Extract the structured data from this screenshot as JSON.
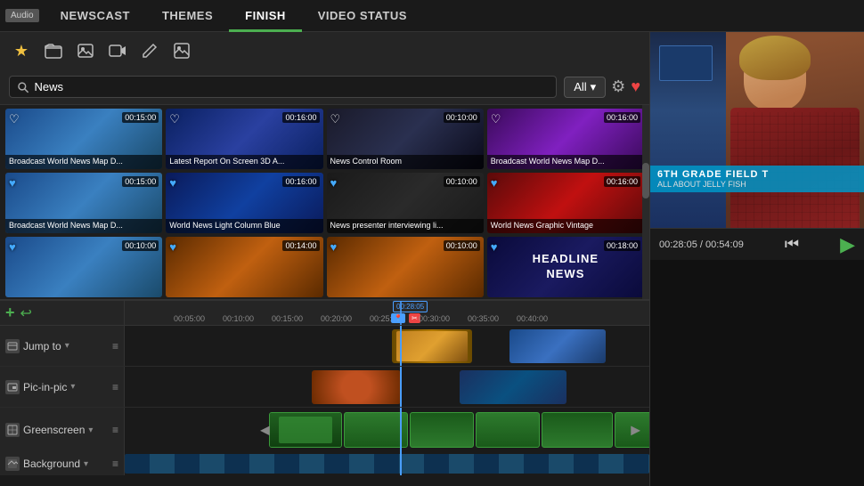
{
  "nav": {
    "audio_badge": "Audio",
    "tabs": [
      "NEWSCAST",
      "THEMES",
      "FINISH",
      "VIDEO STATUS"
    ],
    "active_tab": "NEWSCAST"
  },
  "toolbar": {
    "icons": [
      "★",
      "📁",
      "🖼",
      "📽",
      "✏",
      "🖼"
    ]
  },
  "search": {
    "placeholder": "News",
    "value": "News",
    "filter_label": "All",
    "filter_arrow": "▾"
  },
  "media_items": [
    {
      "id": 1,
      "label": "Broadcast World News Map D...",
      "time": "00:15:00",
      "color": "blue"
    },
    {
      "id": 2,
      "label": "Latest Report On Screen 3D A...",
      "time": "00:16:00",
      "color": "blue"
    },
    {
      "id": 3,
      "label": "News Control Room",
      "time": "00:10:00",
      "color": "dark"
    },
    {
      "id": 4,
      "label": "Broadcast World News Map D...",
      "time": "00:16:00",
      "color": "purple"
    },
    {
      "id": 5,
      "label": "Broadcast World News Map D...",
      "time": "00:15:00",
      "color": "blue"
    },
    {
      "id": 6,
      "label": "World News Light Column Blue",
      "time": "00:16:00",
      "color": "blue"
    },
    {
      "id": 7,
      "label": "News presenter interviewing li...",
      "time": "00:10:00",
      "color": "dark"
    },
    {
      "id": 8,
      "label": "World News Graphic Vintage",
      "time": "00:16:00",
      "color": "red"
    },
    {
      "id": 9,
      "label": "",
      "time": "00:10:00",
      "color": "blue"
    },
    {
      "id": 10,
      "label": "",
      "time": "00:14:00",
      "color": "orange"
    },
    {
      "id": 11,
      "label": "",
      "time": "00:10:00",
      "color": "orange"
    },
    {
      "id": 12,
      "label": "HEADLINE NEWS",
      "time": "00:18:00",
      "color": "blue"
    }
  ],
  "preview": {
    "current_time": "00:28:05",
    "total_time": "00:54:09",
    "lower_third_title": "6TH GRADE FIELD T",
    "lower_third_sub": "ALL ABOUT JELLY FISH"
  },
  "timeline": {
    "playhead_time": "00:28:05",
    "ticks": [
      {
        "label": "00:05:00",
        "pos": 55
      },
      {
        "label": "00:10:00",
        "pos": 110
      },
      {
        "label": "00:15:00",
        "pos": 165
      },
      {
        "label": "00:20:00",
        "pos": 220
      },
      {
        "label": "00:25:00",
        "pos": 275
      },
      {
        "label": "00:28:05",
        "pos": 309
      },
      {
        "label": "00:30:00",
        "pos": 330
      },
      {
        "label": "00:35:00",
        "pos": 385
      },
      {
        "label": "00:40:00",
        "pos": 440
      }
    ],
    "tracks": [
      {
        "id": "jump-to",
        "label": "Jump to"
      },
      {
        "id": "pic-in-pic",
        "label": "Pic-in-pic"
      },
      {
        "id": "greenscreen",
        "label": "Greenscreen"
      },
      {
        "id": "background",
        "label": "Background"
      }
    ]
  }
}
